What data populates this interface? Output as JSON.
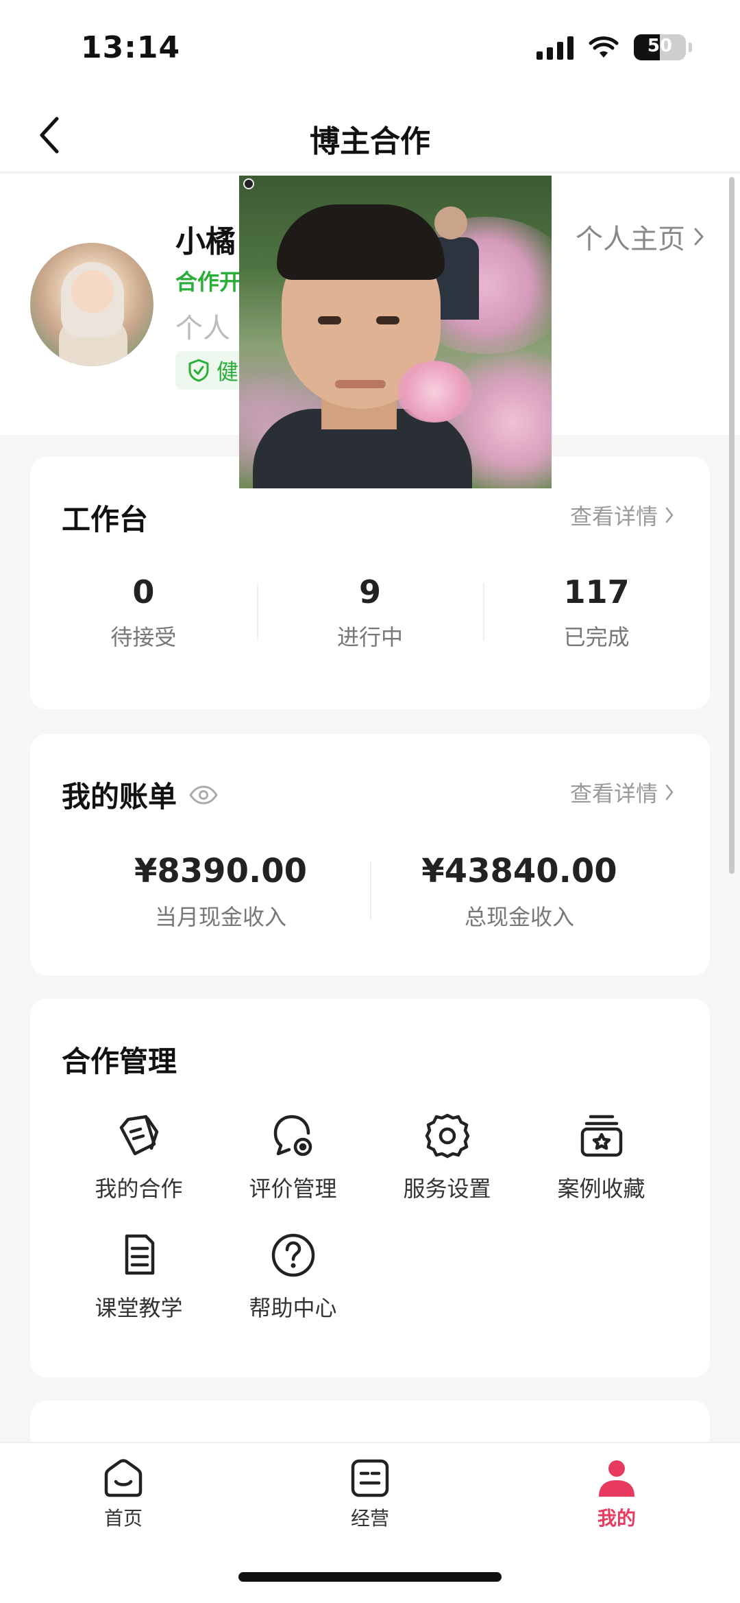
{
  "status_bar": {
    "time": "13:14",
    "battery": "50"
  },
  "nav": {
    "title": "博主合作"
  },
  "profile": {
    "name": "小橘",
    "cooperation_status": "合作开",
    "intro": "个人",
    "health_badge": "健",
    "homepage_link": "个人主页"
  },
  "workbench": {
    "title": "工作台",
    "detail_link": "查看详情",
    "stats": [
      {
        "value": "0",
        "label": "待接受"
      },
      {
        "value": "9",
        "label": "进行中"
      },
      {
        "value": "117",
        "label": "已完成"
      }
    ]
  },
  "bill": {
    "title": "我的账单",
    "detail_link": "查看详情",
    "items": [
      {
        "value": "¥8390.00",
        "label": "当月现金收入"
      },
      {
        "value": "¥43840.00",
        "label": "总现金收入"
      }
    ]
  },
  "manage": {
    "title": "合作管理",
    "items": [
      {
        "label": "我的合作",
        "icon": "tags-icon"
      },
      {
        "label": "评价管理",
        "icon": "review-bubble-icon"
      },
      {
        "label": "服务设置",
        "icon": "gear-icon"
      },
      {
        "label": "案例收藏",
        "icon": "star-box-icon"
      },
      {
        "label": "课堂教学",
        "icon": "document-icon"
      },
      {
        "label": "帮助中心",
        "icon": "help-circle-icon"
      }
    ]
  },
  "tab_bar": {
    "tabs": [
      {
        "label": "首页",
        "icon": "home-smile-icon"
      },
      {
        "label": "经营",
        "icon": "list-box-icon"
      },
      {
        "label": "我的",
        "icon": "person-icon",
        "active": true
      }
    ],
    "active_color": "#e83a5f"
  },
  "colors": {
    "accent_green": "#2aae38",
    "accent_red": "#e83a5f"
  }
}
